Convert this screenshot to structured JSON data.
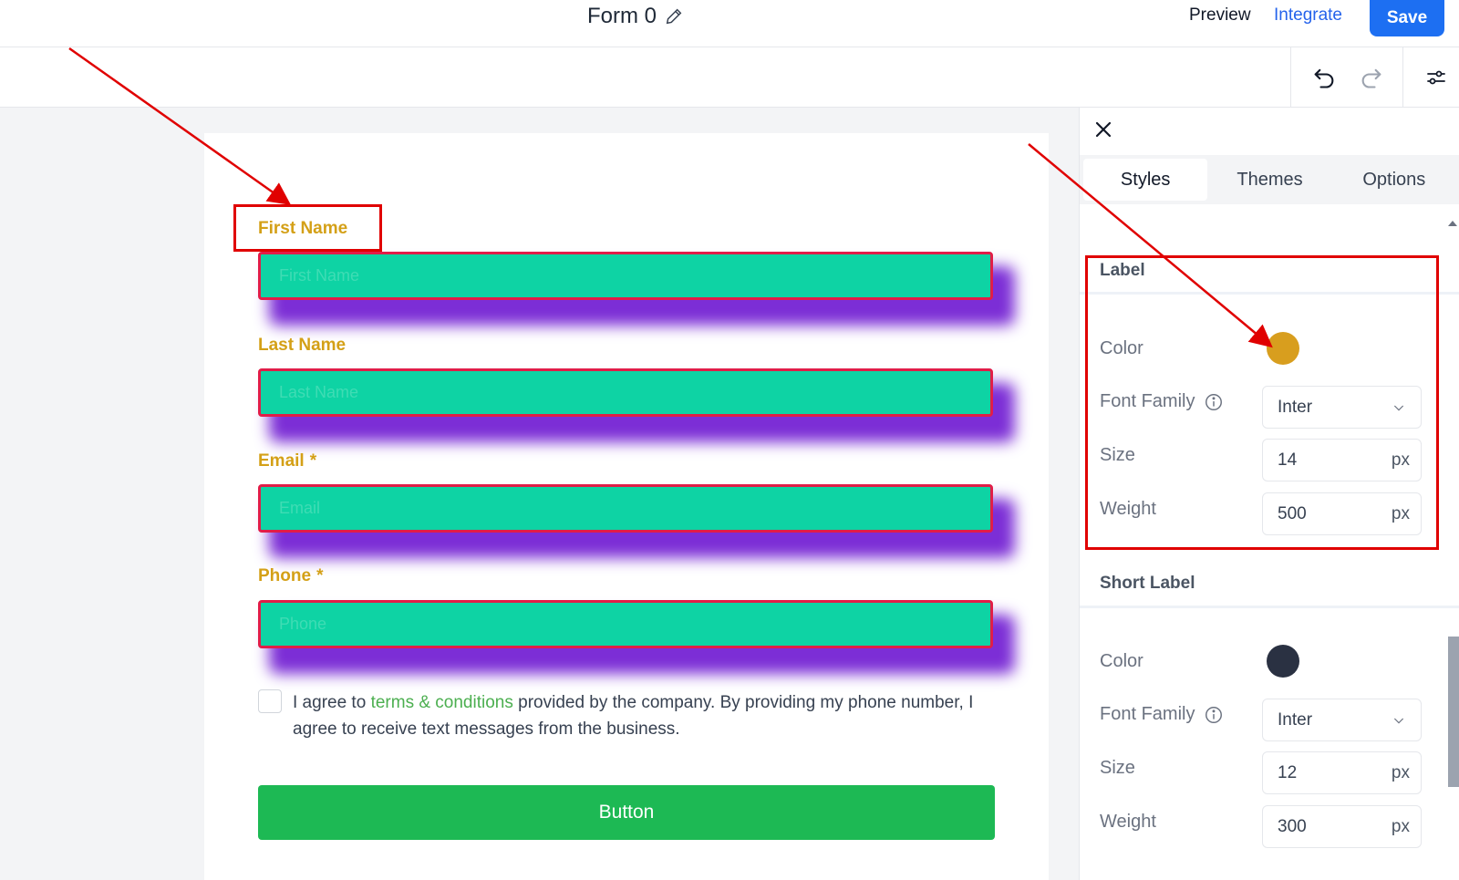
{
  "header": {
    "form_title": "Form 0",
    "preview_label": "Preview",
    "integrate_label": "Integrate",
    "save_label": "Save"
  },
  "form": {
    "fields": [
      {
        "label": "First Name",
        "placeholder": "First Name",
        "required": false
      },
      {
        "label": "Last Name",
        "placeholder": "Last Name",
        "required": false
      },
      {
        "label": "Email",
        "placeholder": "Email",
        "required": true
      },
      {
        "label": "Phone",
        "placeholder": "Phone",
        "required": true
      }
    ],
    "required_marker": "*",
    "agree_prefix": "I agree to ",
    "agree_link": "terms & conditions",
    "agree_suffix": " provided by the company. By providing my phone number, I agree to receive text messages from the business.",
    "button_label": "Button"
  },
  "panel": {
    "tabs": [
      "Styles",
      "Themes",
      "Options"
    ],
    "active_tab": "Styles",
    "sections": [
      {
        "title": "Label",
        "color_label": "Color",
        "color": "#d89e1e",
        "font_family_label": "Font Family",
        "font_family": "Inter",
        "size_label": "Size",
        "size": "14",
        "weight_label": "Weight",
        "weight": "500",
        "unit": "px"
      },
      {
        "title": "Short Label",
        "color_label": "Color",
        "color": "#2a3142",
        "font_family_label": "Font Family",
        "font_family": "Inter",
        "size_label": "Size",
        "size": "12",
        "weight_label": "Weight",
        "weight": "300",
        "unit": "px"
      }
    ]
  },
  "colors": {
    "label": "#d4a017",
    "input_fill": "#0ed3a4",
    "input_border": "#e11d48",
    "input_shadow": "#7c2ed6",
    "button": "#1db954",
    "primary": "#1d6ff2",
    "annotation": "#e00000"
  }
}
